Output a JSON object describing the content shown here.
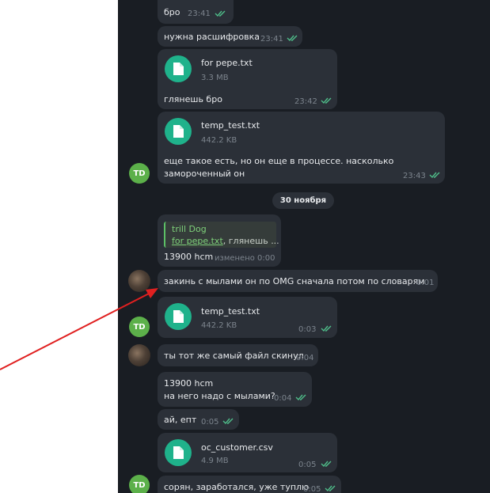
{
  "colors": {
    "chat_bg": "#191d23",
    "bubble": "#2b3038",
    "accent_green": "#1fb28b",
    "read_checks": "#4fbe8a",
    "arrow": "#e02020"
  },
  "messages": {
    "m1": {
      "text": "бро",
      "time": "23:41"
    },
    "m2": {
      "text": "нужна расшифровка",
      "time": "23:41"
    },
    "m3": {
      "file": "for pepe.txt",
      "size": "3.3 MB",
      "text": "глянешь бро",
      "time": "23:42"
    },
    "m4": {
      "file": "temp_test.txt",
      "size": "442.2 KB",
      "text_line1": "еще такое есть, но он еще в процессе. насколько",
      "text_line2": "замороченный он",
      "time": "23:43"
    },
    "date_separator": "30 ноября",
    "m5": {
      "reply_author": "trill Dog",
      "reply_file": "for pepe.txt",
      "reply_rest": ", глянешь ...",
      "text": "13900 hcm",
      "edited": "изменено 0:00"
    },
    "m6": {
      "text": "закинь с мылами он по OMG сначала потом по словарям",
      "time": "0:01"
    },
    "m7": {
      "file": "temp_test.txt",
      "size": "442.2 KB",
      "time": "0:03"
    },
    "m8": {
      "text": "ты тот же самый файл скинул",
      "time": "0:04"
    },
    "m9": {
      "text_line1": "13900 hcm",
      "text_line2": "на него надо с мылами?",
      "time": "0:04"
    },
    "m10": {
      "text": "ай, епт",
      "time": "0:05"
    },
    "m11": {
      "file": "oc_customer.csv",
      "size": "4.9 MB",
      "time": "0:05"
    },
    "m12": {
      "text": "сорян, заработался, уже туплю",
      "time": "0:05"
    }
  },
  "avatars": {
    "own_initials": "TD"
  }
}
